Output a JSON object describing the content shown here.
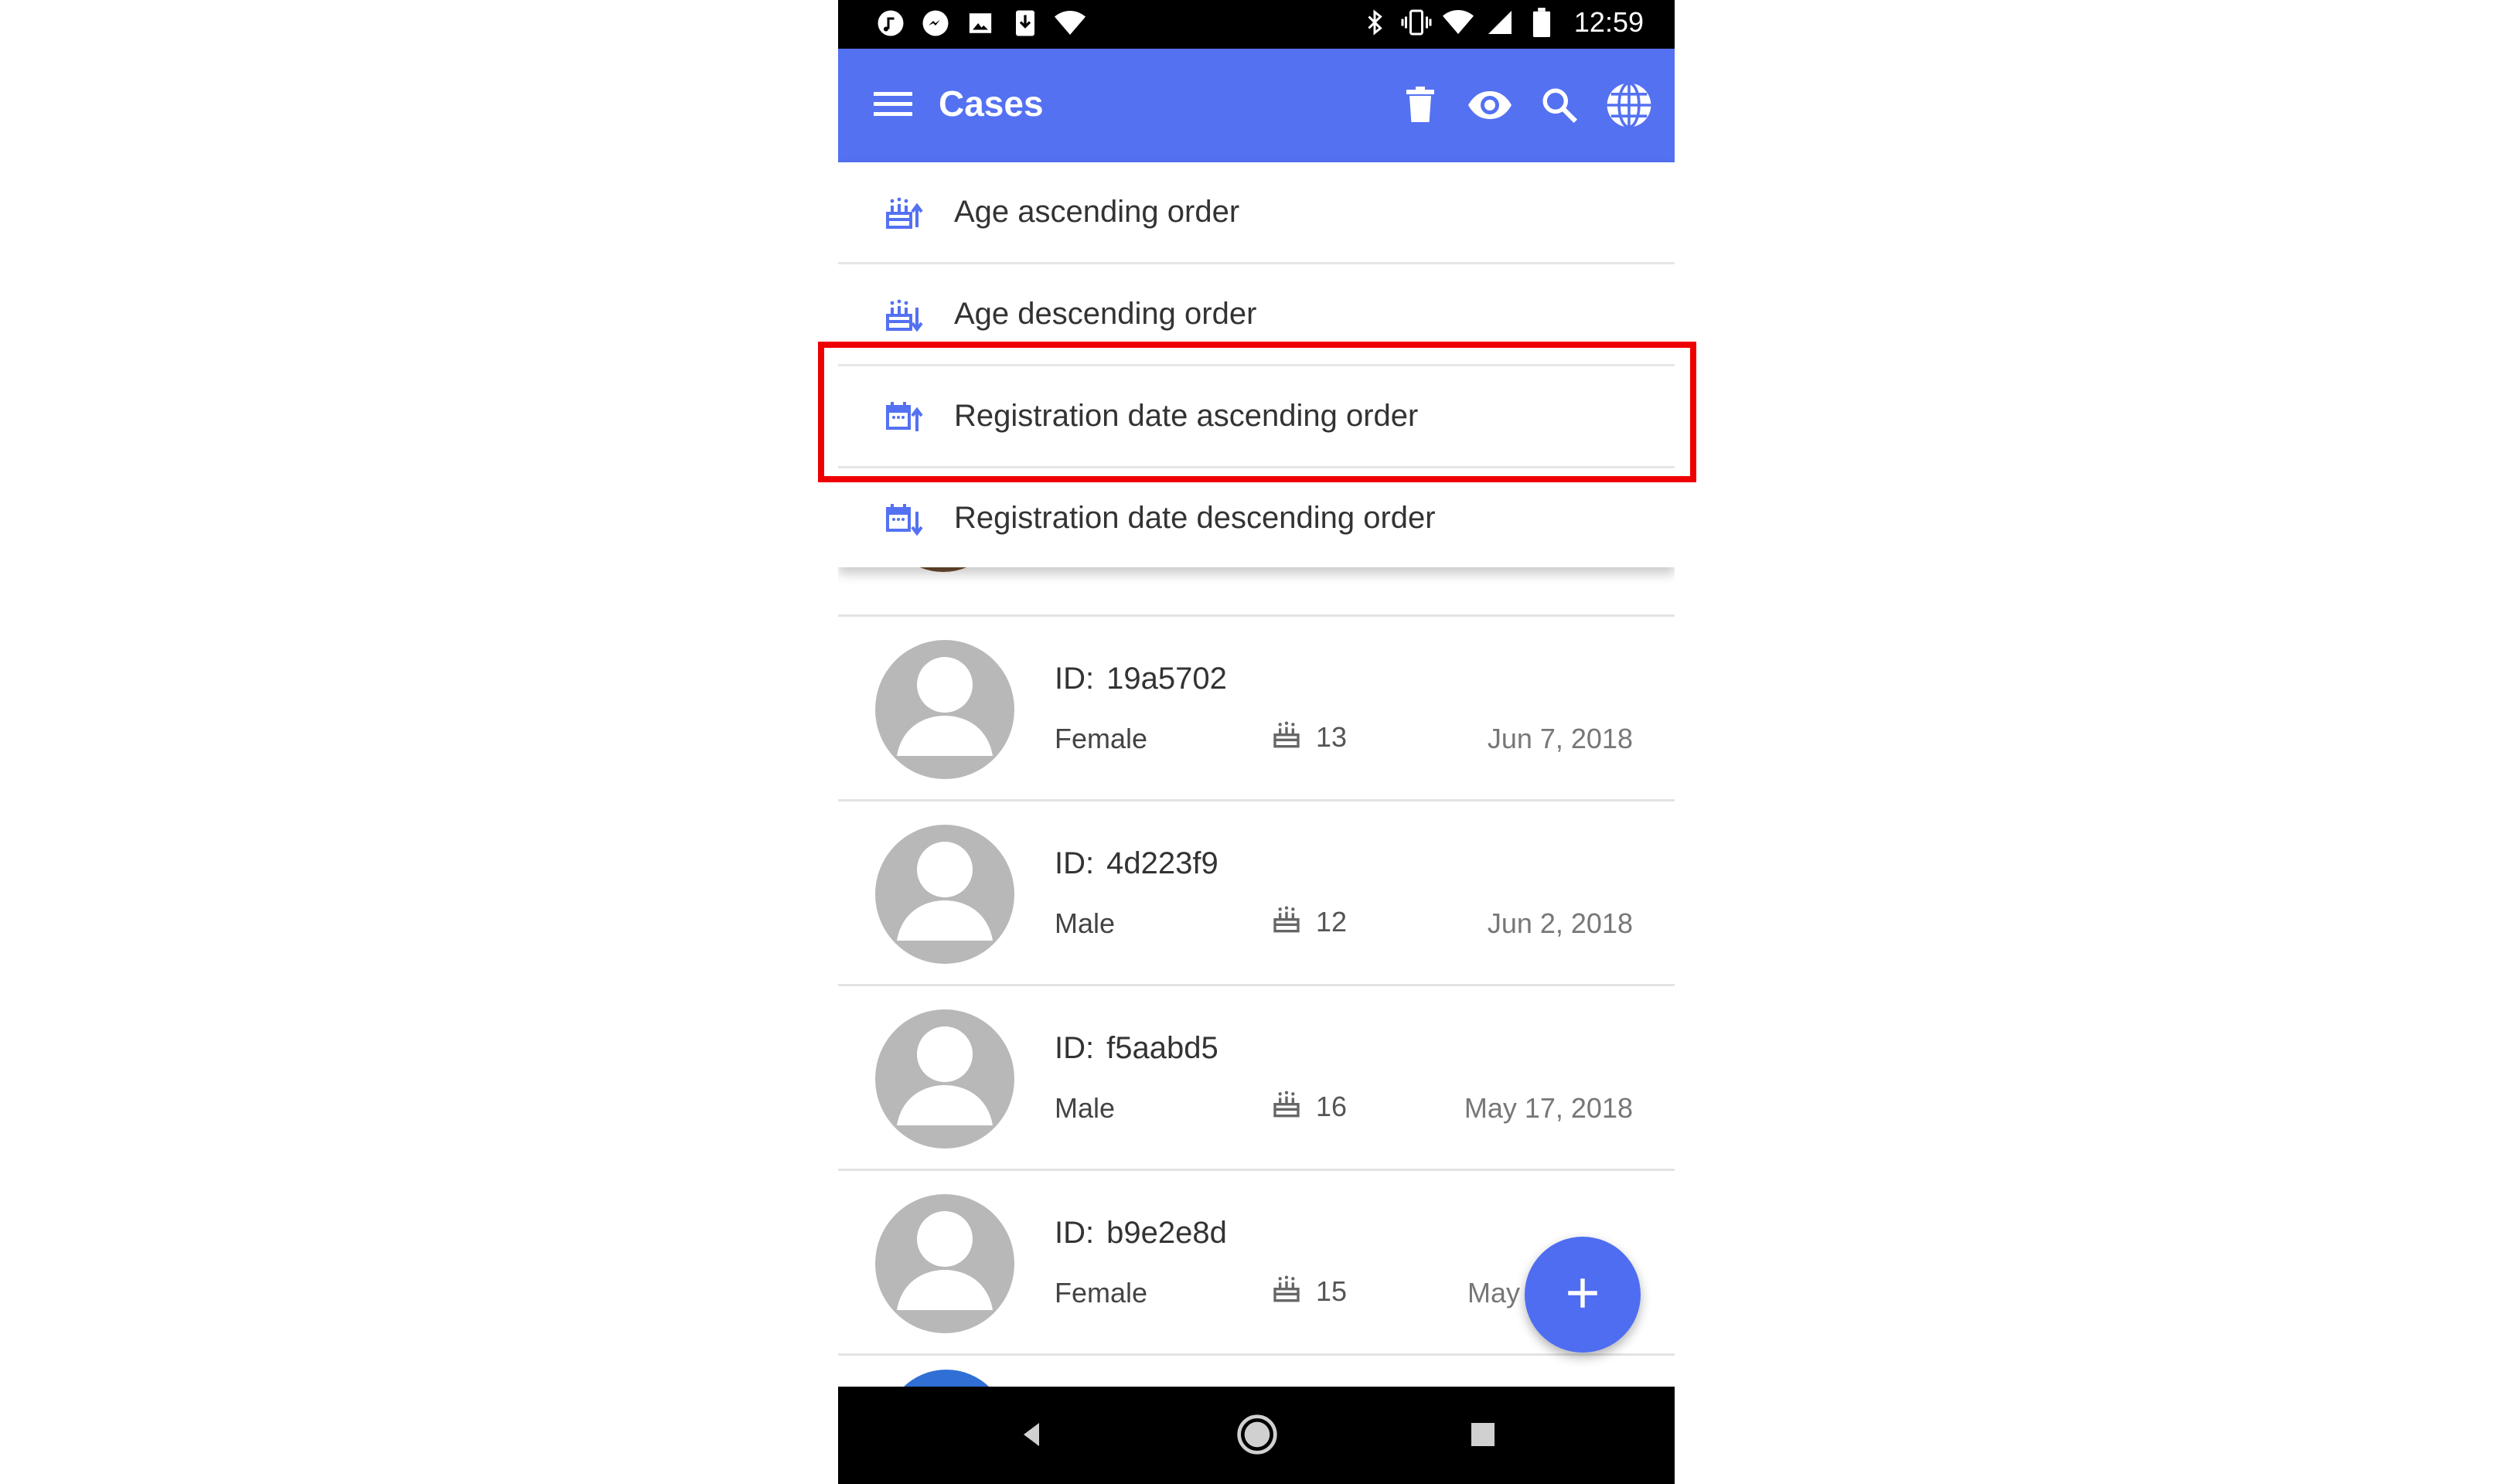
{
  "status_bar": {
    "time": "12:59",
    "left_icons": [
      "music-icon",
      "messenger-icon",
      "image-icon",
      "download-icon",
      "wifi-icon"
    ],
    "right_icons": [
      "bluetooth-icon",
      "vibrate-icon",
      "wifi-icon",
      "signal-icon",
      "battery-icon"
    ]
  },
  "app_bar": {
    "title": "Cases",
    "actions": [
      "delete-icon",
      "eye-icon",
      "search-icon",
      "globe-icon"
    ],
    "color": "#5471f2"
  },
  "sort_menu": {
    "items": [
      {
        "label": "Age ascending order",
        "icon": "cake-sort-up-icon"
      },
      {
        "label": "Age descending order",
        "icon": "cake-sort-down-icon"
      },
      {
        "label": "Registration date ascending order",
        "icon": "calendar-sort-up-icon",
        "highlighted": true
      },
      {
        "label": "Registration date descending order",
        "icon": "calendar-sort-down-icon"
      }
    ],
    "highlight_color": "#ee0000"
  },
  "cases": [
    {
      "id_label": "ID:",
      "id": "19a5702",
      "gender": "Female",
      "age": "13",
      "date": "Jun 7, 2018"
    },
    {
      "id_label": "ID:",
      "id": "4d223f9",
      "gender": "Male",
      "age": "12",
      "date": "Jun 2, 2018"
    },
    {
      "id_label": "ID:",
      "id": "f5aabd5",
      "gender": "Male",
      "age": "16",
      "date": "May 17, 2018"
    },
    {
      "id_label": "ID:",
      "id": "b9e2e8d",
      "gender": "Female",
      "age": "15",
      "date": "May"
    }
  ],
  "fab": {
    "icon": "plus-icon",
    "color": "#4f6df1"
  },
  "nav_bar": {
    "buttons": [
      "back-icon",
      "home-icon",
      "recents-icon"
    ]
  }
}
